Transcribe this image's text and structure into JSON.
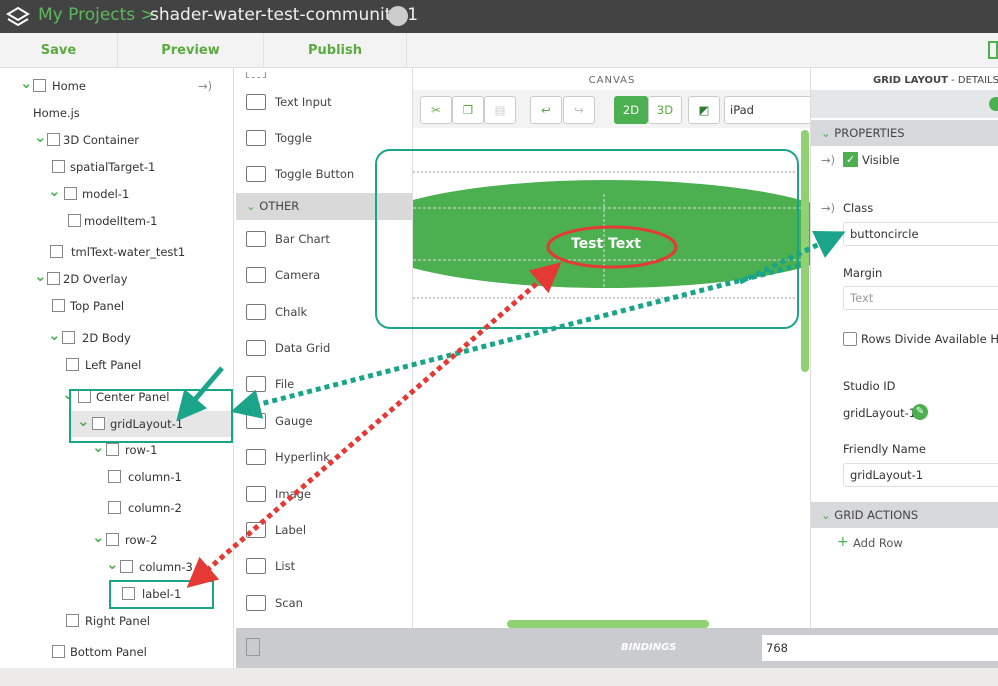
{
  "header": {
    "breadcrumb_root": "My Projects >",
    "project_title": "shader-water-test-community-1"
  },
  "toolbar": {
    "save": "Save",
    "preview": "Preview",
    "publish": "Publish"
  },
  "tree": {
    "items": [
      {
        "label": "Home",
        "chevron": true
      },
      {
        "label": "Home.js"
      },
      {
        "label": "3D Container",
        "chevron": true
      },
      {
        "label": "spatialTarget-1"
      },
      {
        "label": "model-1",
        "chevron": true
      },
      {
        "label": "modelItem-1"
      },
      {
        "label": "tmlText-water_test1"
      },
      {
        "label": "2D Overlay",
        "chevron": true
      },
      {
        "label": "Top Panel"
      },
      {
        "label": "2D Body",
        "chevron": true
      },
      {
        "label": "Left Panel"
      },
      {
        "label": "Center Panel",
        "chevron": true
      },
      {
        "label": "gridLayout-1",
        "chevron": true,
        "selected": true
      },
      {
        "label": "row-1",
        "chevron": true
      },
      {
        "label": "column-1"
      },
      {
        "label": "column-2"
      },
      {
        "label": "row-2",
        "chevron": true
      },
      {
        "label": "column-3",
        "chevron": true
      },
      {
        "label": "label-1"
      },
      {
        "label": "Right Panel"
      },
      {
        "label": "Bottom Panel"
      }
    ],
    "binding_arrow": "→)"
  },
  "palette": {
    "items": [
      "Text Input",
      "Toggle",
      "Toggle Button"
    ],
    "section_other": "OTHER",
    "other_items": [
      "Bar Chart",
      "Camera",
      "Chalk",
      "Data Grid",
      "File",
      "Gauge",
      "Hyperlink",
      "Image",
      "Label",
      "List",
      "Scan"
    ]
  },
  "canvas": {
    "header": "CANVAS",
    "mode_2d": "2D",
    "mode_3d": "3D",
    "device": "iPad",
    "preview_text": "Test Text"
  },
  "details": {
    "header_bold": "GRID LAYOUT",
    "header_rest": " - DETAILS",
    "properties": "PROPERTIES",
    "visible_label": "Visible",
    "visible_checked": true,
    "class_label": "Class",
    "class_value": "buttoncircle",
    "margin_label": "Margin",
    "margin_placeholder": "Text",
    "rows_divide_label": "Rows Divide Available Height",
    "rows_divide_checked": false,
    "studio_id_label": "Studio ID",
    "studio_id_value": "gridLayout-1",
    "friendly_name_label": "Friendly Name",
    "friendly_name_value": "gridLayout-1",
    "grid_actions": "GRID ACTIONS",
    "add_row": "Add Row"
  },
  "bindings": {
    "label": "BINDINGS",
    "value": "768"
  },
  "colors": {
    "accent": "#4caf50",
    "annotation_teal": "#1aa58a",
    "annotation_red": "#e53935",
    "topbar": "#434343"
  }
}
